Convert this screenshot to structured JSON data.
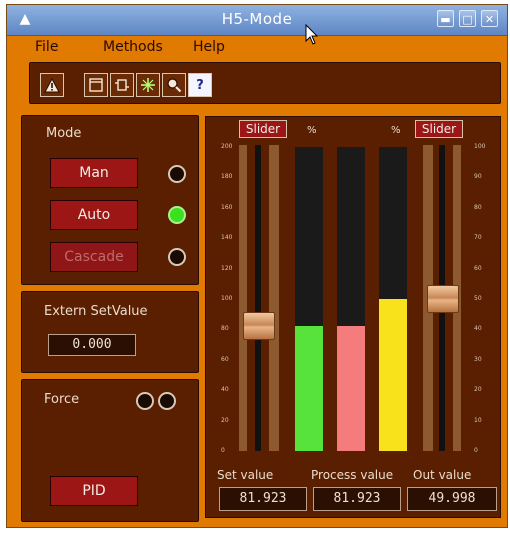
{
  "window": {
    "title": "H5-Mode"
  },
  "menu": [
    "File",
    "Methods",
    "Help"
  ],
  "toolbar": {
    "buttons": [
      "warning-icon",
      "window-icon",
      "function-block-icon",
      "crosshair-icon",
      "zoom-icon",
      "help-icon"
    ],
    "help_glyph": "?"
  },
  "mode": {
    "label": "Mode",
    "buttons": [
      {
        "label": "Man",
        "enabled": true,
        "indicator": "off"
      },
      {
        "label": "Auto",
        "enabled": true,
        "indicator": "on"
      },
      {
        "label": "Cascade",
        "enabled": false,
        "indicator": "off"
      }
    ]
  },
  "extern": {
    "label": "Extern SetValue",
    "value": "0.000"
  },
  "force": {
    "label": "Force",
    "pid_label": "PID"
  },
  "gauges": {
    "left_slider_label": "Slider",
    "right_slider_label": "Slider",
    "percent_left": "%",
    "percent_right": "%",
    "left_axis": {
      "min": 0,
      "max": 200,
      "step": 20,
      "labels": [
        "200",
        "180",
        "160",
        "140",
        "120",
        "100",
        "80",
        "60",
        "40",
        "20",
        "0"
      ]
    },
    "right_axis": {
      "min": 0,
      "max": 100,
      "step": 10,
      "labels": [
        "100",
        "90",
        "80",
        "70",
        "60",
        "50",
        "40",
        "30",
        "20",
        "10",
        "0"
      ]
    },
    "left_slider_value": 82,
    "right_slider_value": 50,
    "bars": [
      {
        "name": "Set value",
        "percent": 41,
        "color": "#57e23c"
      },
      {
        "name": "Process value",
        "percent": 41,
        "color": "#f47c7c"
      },
      {
        "name": "Out value",
        "percent": 50,
        "color": "#f7e21c"
      }
    ]
  },
  "readouts": {
    "set_label": "Set value",
    "process_label": "Process value",
    "out_label": "Out value",
    "set_value": "81.923",
    "process_value": "81.923",
    "out_value": "49.998"
  }
}
